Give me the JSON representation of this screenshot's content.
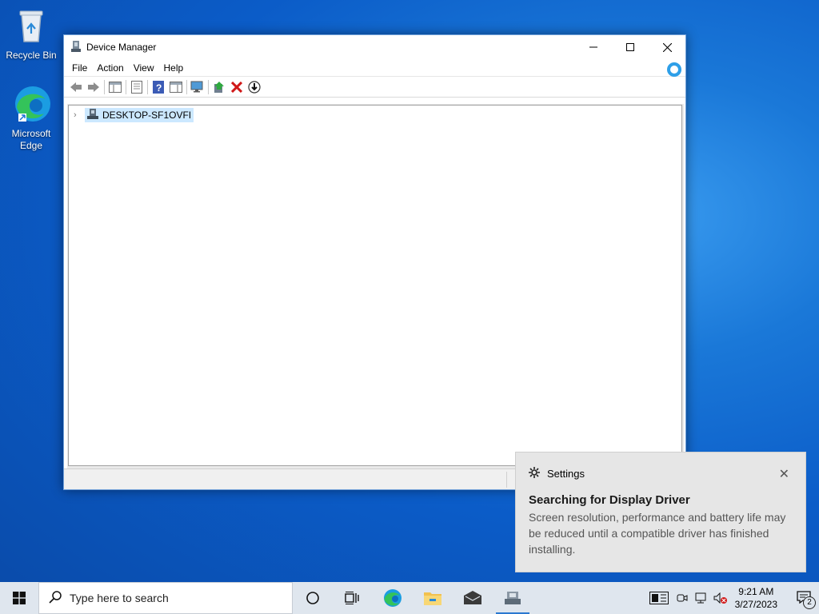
{
  "desktop": {
    "icons": [
      {
        "label": "Recycle Bin",
        "icon": "recycle-bin-icon"
      },
      {
        "label": "Microsoft Edge",
        "icon": "edge-icon"
      }
    ]
  },
  "window": {
    "title": "Device Manager",
    "controls": {
      "minimize": "—",
      "maximize": "☐",
      "close": "✕"
    },
    "menu": [
      "File",
      "Action",
      "View",
      "Help"
    ],
    "toolbar": [
      "back-icon",
      "forward-icon",
      "show-hide-console-tree-icon",
      "properties-icon",
      "help-icon",
      "action-pane-icon",
      "scan-hardware-icon",
      "update-driver-icon",
      "uninstall-device-icon",
      "disable-device-icon"
    ],
    "tree": {
      "root": "DESKTOP-SF1OVFI",
      "expander": "›"
    }
  },
  "toast": {
    "app": "Settings",
    "close": "✕",
    "title": "Searching for Display Driver",
    "body": "Screen resolution, performance and battery life may be reduced until a compatible driver has finished installing."
  },
  "taskbar": {
    "search_placeholder": "Type here to search",
    "items": [
      "cortana-icon",
      "task-view-icon",
      "edge-icon",
      "file-explorer-icon",
      "mail-icon",
      "device-manager-icon"
    ],
    "clock": {
      "time": "9:21 AM",
      "date": "3/27/2023"
    },
    "notification_count": "2"
  },
  "colors": {
    "accent": "#2a78d0",
    "selection": "#cce8ff",
    "cortana": "#2e9fe8"
  }
}
